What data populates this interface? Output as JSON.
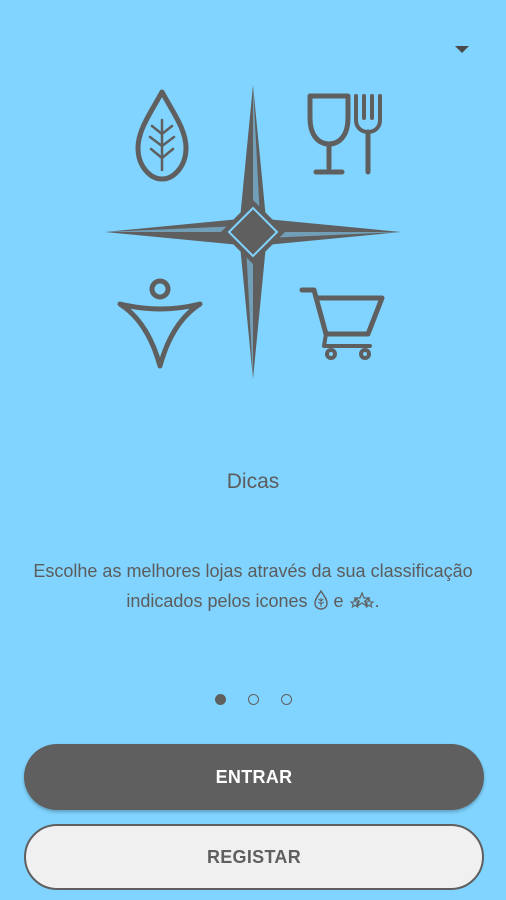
{
  "menu": {
    "dropdown_icon": "caret-down-icon"
  },
  "hero": {
    "icons": [
      "leaf-drop-icon",
      "compass-star-icon",
      "wine-fork-icon",
      "person-icon",
      "shopping-cart-icon"
    ]
  },
  "slide": {
    "title": "Dicas",
    "description_part1": "Escolhe as melhores lojas através da sua classificação indicados pelos icones",
    "description_conjunction": "e",
    "description_end": "."
  },
  "pager": {
    "count": 3,
    "active_index": 0
  },
  "actions": {
    "enter_label": "ENTRAR",
    "register_label": "REGISTAR"
  },
  "colors": {
    "background": "#80d4ff",
    "icon": "#5f5f5f",
    "primary_button": "#5f5f5f",
    "secondary_button": "#f0f0f0"
  }
}
